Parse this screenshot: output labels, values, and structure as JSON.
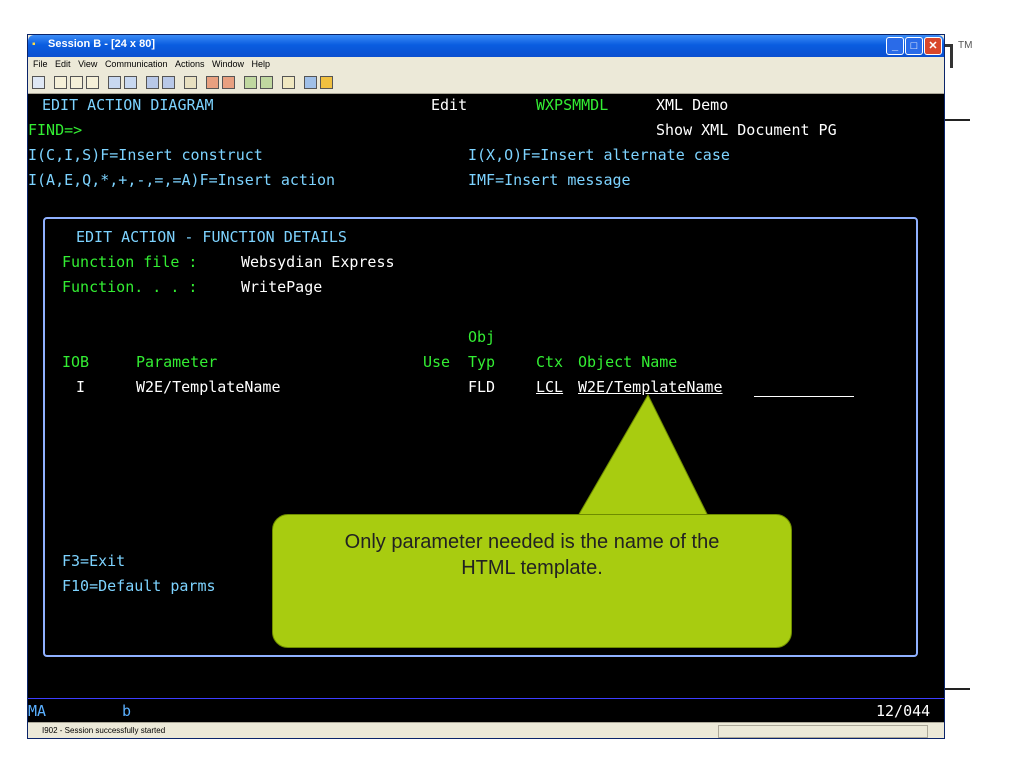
{
  "window": {
    "title": "Session B - [24 x 80]",
    "menu": [
      "File",
      "Edit",
      "View",
      "Communication",
      "Actions",
      "Window",
      "Help"
    ],
    "status_message": "I902 - Session successfully started"
  },
  "screen": {
    "header": {
      "title": "EDIT ACTION DIAGRAM",
      "mode": "Edit",
      "program": "WXPSMMDL",
      "right_line1": "XML Demo",
      "right_line2": "Show XML Document PG",
      "find": "FIND=>",
      "hint1": "I(C,I,S)F=Insert construct",
      "hint2": "I(X,O)F=Insert alternate case",
      "hint3": "I(A,E,Q,*,+,-,=,=A)F=Insert action",
      "hint4": "IMF=Insert message"
    },
    "panel": {
      "title": "EDIT ACTION - FUNCTION DETAILS",
      "file_label": "Function file :",
      "file_value": "Websydian Express",
      "func_label": "Function. . . :",
      "func_value": "WritePage",
      "col_obj": "Obj",
      "col_iob": "IOB",
      "col_parameter": "Parameter",
      "col_use": "Use",
      "col_typ": "Typ",
      "col_ctx": "Ctx",
      "col_objname": "Object Name",
      "row": {
        "iob": "I",
        "parameter": "W2E/TemplateName",
        "typ": "FLD",
        "ctx": "LCL",
        "object_name": "W2E/TemplateName"
      },
      "f3": "F3=Exit",
      "f10": "F10=Default parms"
    },
    "status": {
      "ma": "MA",
      "b": "b",
      "position": "12/044"
    }
  },
  "callout": {
    "line1": "Only parameter needed is the name of the",
    "line2": "HTML template."
  },
  "trademark": "TM"
}
